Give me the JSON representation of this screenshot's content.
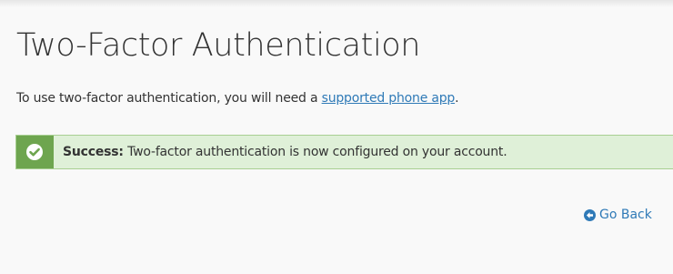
{
  "page": {
    "title": "Two-Factor Authentication",
    "intro_text": "To use two-factor authentication, you will need a ",
    "intro_link": "supported phone app",
    "intro_suffix": "."
  },
  "alert": {
    "icon": "check-circle-icon",
    "label": "Success:",
    "message": " Two-factor authentication is now configured on your account.",
    "bg_color": "#dff0d8",
    "icon_bg_color": "#6ea54f"
  },
  "actions": {
    "go_back_icon": "arrow-left-circle-icon",
    "go_back_label": "Go Back"
  },
  "colors": {
    "link": "#2f7ab7",
    "text": "#333333"
  }
}
